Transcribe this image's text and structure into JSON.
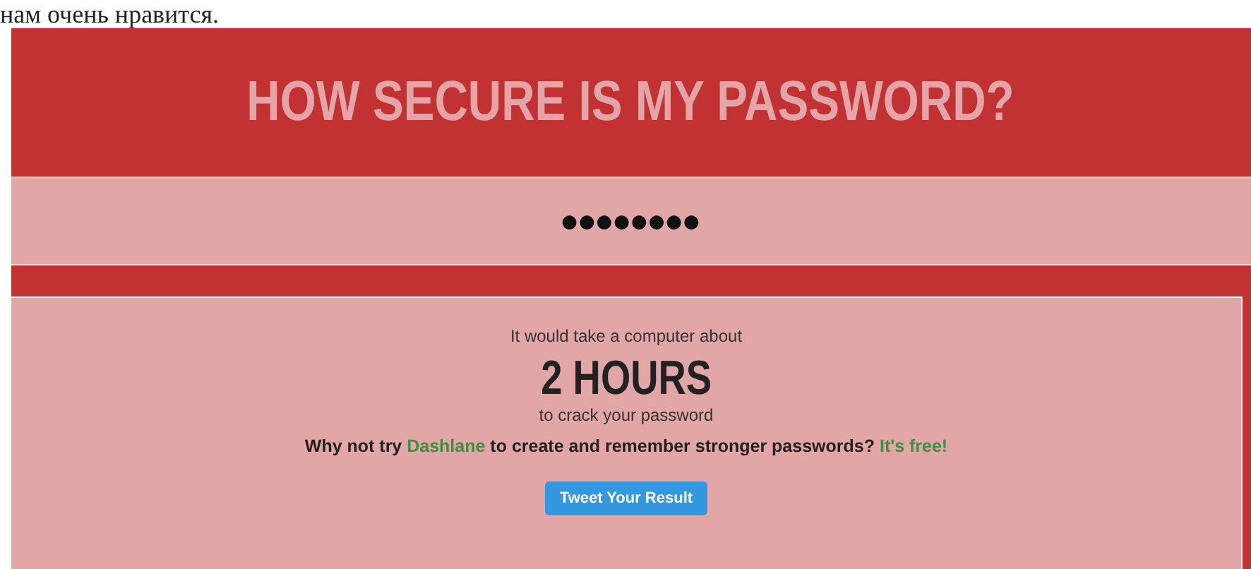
{
  "top_text": "нам очень нравится.",
  "header": {
    "title": "HOW SECURE IS MY PASSWORD?"
  },
  "password_field": {
    "value": "●●●●●●●●"
  },
  "result": {
    "intro": "It would take a computer about",
    "time": "2 HOURS",
    "outro": "to crack your password",
    "promo": {
      "before": "Why not try ",
      "link": "Dashlane",
      "middle": " to create and remember stronger passwords? ",
      "link2": "It's free!"
    },
    "button": "Tweet Your Result"
  }
}
